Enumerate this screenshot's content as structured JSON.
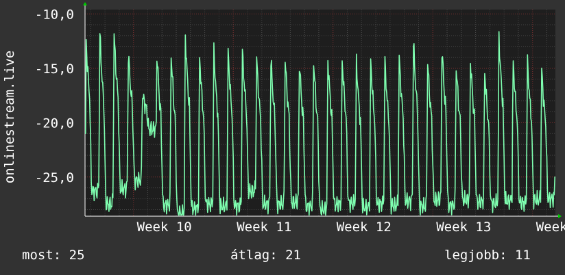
{
  "chart_data": {
    "type": "line",
    "ylabel": "onlinestream.live",
    "ylim": [
      -28.6,
      -9.6
    ],
    "y_ticks": [
      -10,
      -15,
      -20,
      -25
    ],
    "y_tick_labels": [
      "-10,0",
      "-15,0",
      "-20,0",
      "-25,0"
    ],
    "x_ticks": [
      "Week 10",
      "Week 11",
      "Week 12",
      "Week 13",
      "Week"
    ],
    "grid": true,
    "series": [
      {
        "color": "#7fffb0",
        "period_days": 1,
        "x_range_days": [
          -3.4,
          29.6
        ],
        "x_tick_days": [
          0,
          7,
          14,
          21,
          28
        ],
        "daily_peaks": [
          -11.6,
          -11.9,
          -12.0,
          -13.8,
          -17.5,
          -13.7,
          -13.7,
          -12.2,
          -14.0,
          -13.5,
          -13.5,
          -13.6,
          -14.2,
          -14.2,
          -14.3,
          -14.5,
          -14.4,
          -14.3,
          -14.2,
          -14.5,
          -14.4,
          -14.5,
          -14.1,
          -12.6,
          -14.6,
          -13.2,
          -14.9,
          -14.3,
          -15.3,
          -12.3,
          -14.5,
          -14.5,
          -15.3
        ],
        "daily_troughs": [
          -26.3,
          -27.5,
          -26.1,
          -25.3,
          -20.6,
          -27.6,
          -28.4,
          -27.9,
          -27.5,
          -27.7,
          -27.7,
          -26.3,
          -27.5,
          -27.5,
          -27.3,
          -27.7,
          -28.0,
          -27.5,
          -27.4,
          -27.8,
          -27.5,
          -27.6,
          -27.2,
          -27.7,
          -27.1,
          -27.6,
          -27.1,
          -27.3,
          -27.4,
          -27.2,
          -27.4,
          -27.1,
          -27.0
        ],
        "first_value": -21.0,
        "last_value": -25.0
      }
    ]
  },
  "stats": {
    "now_label": "most:",
    "now_value": "25",
    "avg_label": "átlag:",
    "avg_value": "21",
    "max_label": "legjobb:",
    "max_value": "11"
  },
  "colors": {
    "background": "#323232",
    "plot_background": "#1e1e1e",
    "grid_minor": "#4a4a4a",
    "grid_major": "#803030",
    "line": "#7fffb0",
    "axis_arrow": "#00cc00"
  }
}
